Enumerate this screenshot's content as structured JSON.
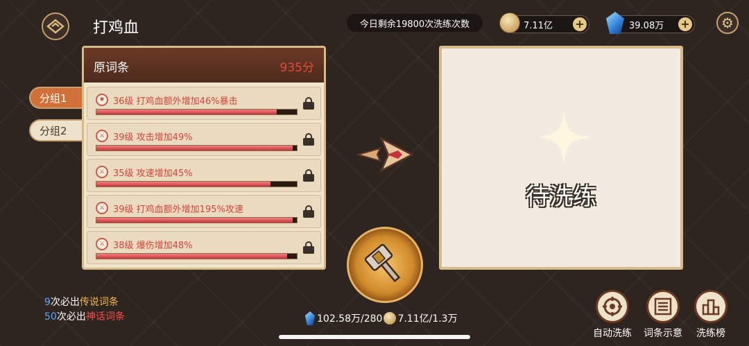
{
  "header": {
    "title": "打鸡血",
    "remaining": "今日剩余19800次洗练次数",
    "gold": "7.11亿",
    "crystal": "39.08万",
    "plus": "+"
  },
  "groups": [
    {
      "label": "分组1",
      "active": true
    },
    {
      "label": "分组2",
      "active": false
    }
  ],
  "affix_panel": {
    "title": "原词条",
    "score": "935分",
    "affixes": [
      {
        "text": "36级 打鸡血额外增加46%暴击",
        "progress": 0.9
      },
      {
        "text": "39级 攻击增加49%",
        "progress": 0.98
      },
      {
        "text": "35级 攻速增加45%",
        "progress": 0.87
      },
      {
        "text": "39级 打鸡血额外增加195%攻速",
        "progress": 0.98
      },
      {
        "text": "38级 爆伤增加48%",
        "progress": 0.95
      }
    ]
  },
  "result_panel": {
    "status": "待洗练"
  },
  "hints": {
    "line1_num": "9",
    "line1_text": "次必出",
    "line1_type": "传说词条",
    "line2_num": "50",
    "line2_text": "次必出",
    "line2_type": "神话词条"
  },
  "cost": {
    "crystal": "102.58万/280",
    "gold": "7.11亿/1.3万"
  },
  "actions": [
    {
      "label": "自动洗练",
      "icon": "auto-refine-icon"
    },
    {
      "label": "词条示意",
      "icon": "list-icon"
    },
    {
      "label": "洗练榜",
      "icon": "podium-icon"
    }
  ],
  "colors": {
    "accent": "#d2703a",
    "score_red": "#e04a3a",
    "affix_red": "#d2453a",
    "legend_gold": "#f2b64a",
    "myth_red": "#ff4a4a",
    "hint_blue": "#5aa8ff"
  }
}
